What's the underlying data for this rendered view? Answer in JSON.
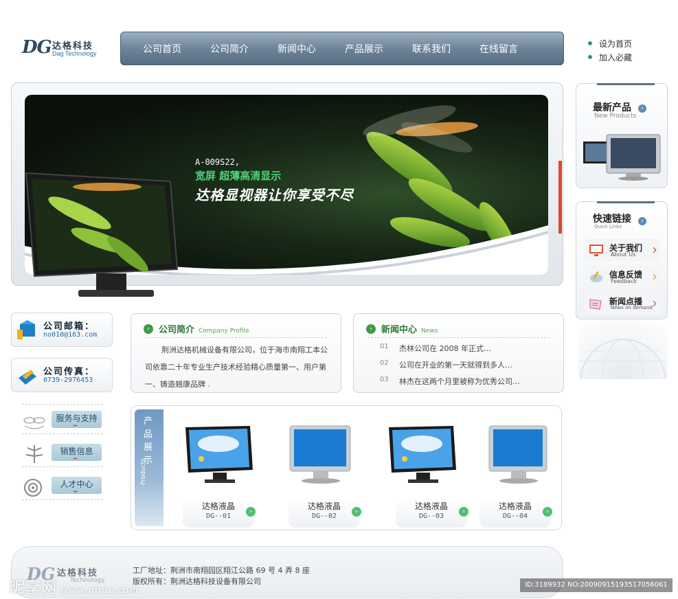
{
  "logo": {
    "mark": "DG",
    "name_cn": "达格科技",
    "name_en": "Dag Technology"
  },
  "nav": {
    "items": [
      "公司首页",
      "公司简介",
      "新闻中心",
      "产品展示",
      "联系我们",
      "在线留言"
    ]
  },
  "top_links": [
    "设为首页",
    "加入必藏"
  ],
  "banner": {
    "model": "A-009S22,",
    "subtitle": "宽屏  超薄高清显示",
    "slogan": "达格显视器让你享受不尽"
  },
  "right": {
    "new_products": {
      "title": "最新产品",
      "subtitle": "New Products"
    },
    "quick_links": {
      "title": "快速链接",
      "subtitle": "Quick Links",
      "items": [
        {
          "cn": "关于我们",
          "en": "About Us",
          "icon": "monitor-icon"
        },
        {
          "cn": "信息反馈",
          "en": "Feedback",
          "icon": "feedback-icon"
        },
        {
          "cn": "新闻点播",
          "en": "News on demand",
          "icon": "news-icon"
        }
      ]
    }
  },
  "contact": {
    "email": {
      "title": "公司邮箱：",
      "value": "no010@163.com"
    },
    "fax": {
      "title": "公司传真：",
      "value": "0739-2976453"
    }
  },
  "services": [
    "服务与支持",
    "销售信息",
    "人才中心"
  ],
  "profile": {
    "title": "公司简介",
    "title_en": "Company Profile",
    "text": "荆洲达格机械设备有限公司，位于海市南翔工本公司依靠二十年专业生产技术经验精心质量第一、用户第一、铸造翘康品牌 ."
  },
  "news": {
    "title": "新闻中心",
    "title_en": "News",
    "items": [
      {
        "num": "01",
        "text": "杰林公司在 2008 年正式…"
      },
      {
        "num": "02",
        "text": "公司在开业的第一天就得到多人…"
      },
      {
        "num": "03",
        "text": "林杰在这两个月里被称为优秀公司…"
      }
    ]
  },
  "products": {
    "tab_cn": "产品展示",
    "tab_en": "Products",
    "items": [
      {
        "name": "达格液晶",
        "code": "DG--01",
        "style": "widescreen"
      },
      {
        "name": "达格液晶",
        "code": "DG--02",
        "style": "crt-blue"
      },
      {
        "name": "达格液晶",
        "code": "DG--03",
        "style": "widescreen"
      },
      {
        "name": "达格液晶",
        "code": "DG--04",
        "style": "crt-blue"
      }
    ]
  },
  "footer": {
    "logo_cn": "达格科技",
    "logo_en": "Technology",
    "address": "工厂地址：荆洲市南翔园区翔江公路 69 号 4 弄 8 座",
    "copyright": "版权所有：荆洲达格科技设备有限公司"
  },
  "watermark": {
    "text": "昵享网",
    "url": "www.nipic.com"
  },
  "image_id": "ID:3189932 NO:20090915193517056061",
  "colors": {
    "nav": "#6d8499",
    "accent_green": "#2b7a34",
    "link_blue": "#1f6ba8",
    "banner_red": "#d94a2b"
  }
}
